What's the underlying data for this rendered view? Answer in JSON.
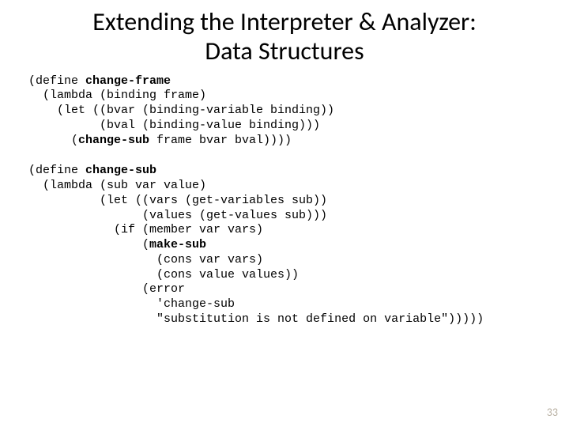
{
  "title_line1": "Extending the Interpreter & Analyzer:",
  "title_line2": "Data Structures",
  "code": {
    "block1": {
      "l1a": "(define ",
      "l1b": "change-frame",
      "l2": "  (lambda (binding frame)",
      "l3": "    (let ((bvar (binding-variable binding))",
      "l4": "          (bval (binding-value binding)))",
      "l5a": "      (",
      "l5b": "change-sub",
      "l5c": " frame bvar bval))))"
    },
    "block2": {
      "l1a": "(define ",
      "l1b": "change-sub",
      "l2": "  (lambda (sub var value)",
      "l3": "          (let ((vars (get-variables sub))",
      "l4": "                (values (get-values sub)))",
      "l5": "            (if (member var vars)",
      "l6a": "                (",
      "l6b": "make-sub",
      "l7": "                  (cons var vars)",
      "l8": "                  (cons value values))",
      "l9": "                (error",
      "l10": "                  'change-sub",
      "l11": "                  \"substitution is not defined on variable\")))))"
    }
  },
  "page_number": "33"
}
